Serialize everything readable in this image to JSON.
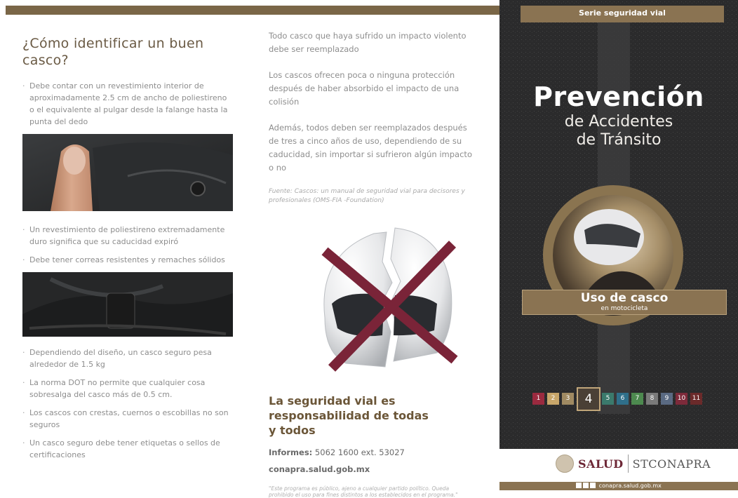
{
  "left": {
    "title": "¿Cómo identificar un buen casco?",
    "bullets_a": [
      "Debe contar con un revestimiento interior de aproximadamente 2.5 cm de ancho de poliestireno o el equivalente al pulgar desde la falange hasta la punta del dedo"
    ],
    "bullets_b": [
      "Un revestimiento de poliestireno extremadamente duro significa que su caducidad expiró",
      "Debe tener correas resistentes y remaches sólidos"
    ],
    "bullets_c": [
      "Dependiendo del diseño, un casco seguro pesa alrededor de 1.5 kg",
      "La norma DOT no permite que cualquier cosa sobresalga del casco más de 0.5 cm.",
      "Los cascos con crestas, cuernos o escobillas no son seguros",
      "Un casco seguro debe tener etiquetas o sellos de certificaciones"
    ]
  },
  "middle": {
    "p1": "Todo casco que haya sufrido un impacto violento debe ser reemplazado",
    "p2": "Los cascos ofrecen poca o ninguna protección después de haber absorbido el impacto de una colisión",
    "p3": "Además, todos deben ser reemplazados después de tres a cinco años de uso, dependiendo de su caducidad, sin importar si sufrieron algún impacto o no",
    "source": "Fuente: Cascos: un manual de seguridad vial para decisores y profesionales (OMS-FIA -Foundation)",
    "slogan": "La seguridad vial es responsabilidad de todas y todos",
    "informes_label": "Informes:",
    "informes_value": " 5062 1600 ext. 53027",
    "website": "conapra.salud.gob.mx",
    "disclaimer": "\"Este programa es público, ajeno a cualquier partido político. Queda prohibido el uso para fines distintos a los establecidos en el programa.\""
  },
  "cover": {
    "series": "Serie seguridad vial",
    "title": "Prevención",
    "subtitle1": "de Accidentes",
    "subtitle2": "de Tránsito",
    "topic": "Uso de casco",
    "topic_sub": "en motocicleta",
    "scale": [
      "1",
      "2",
      "3",
      "4",
      "5",
      "6",
      "7",
      "8",
      "9",
      "10",
      "11"
    ],
    "current": "4",
    "scale_colors": [
      "#9b2a3f",
      "#c8a66a",
      "#a08a62",
      "#4a4036",
      "#3b7a6c",
      "#2f6f8a",
      "#4d8a4f",
      "#7a7a7a",
      "#5a6a82",
      "#7d2a3a",
      "#6b2a2a"
    ]
  },
  "footer": {
    "salud": "SALUD",
    "stconapra": "STCONAPRA",
    "website": "conapra.salud.gob.mx"
  }
}
